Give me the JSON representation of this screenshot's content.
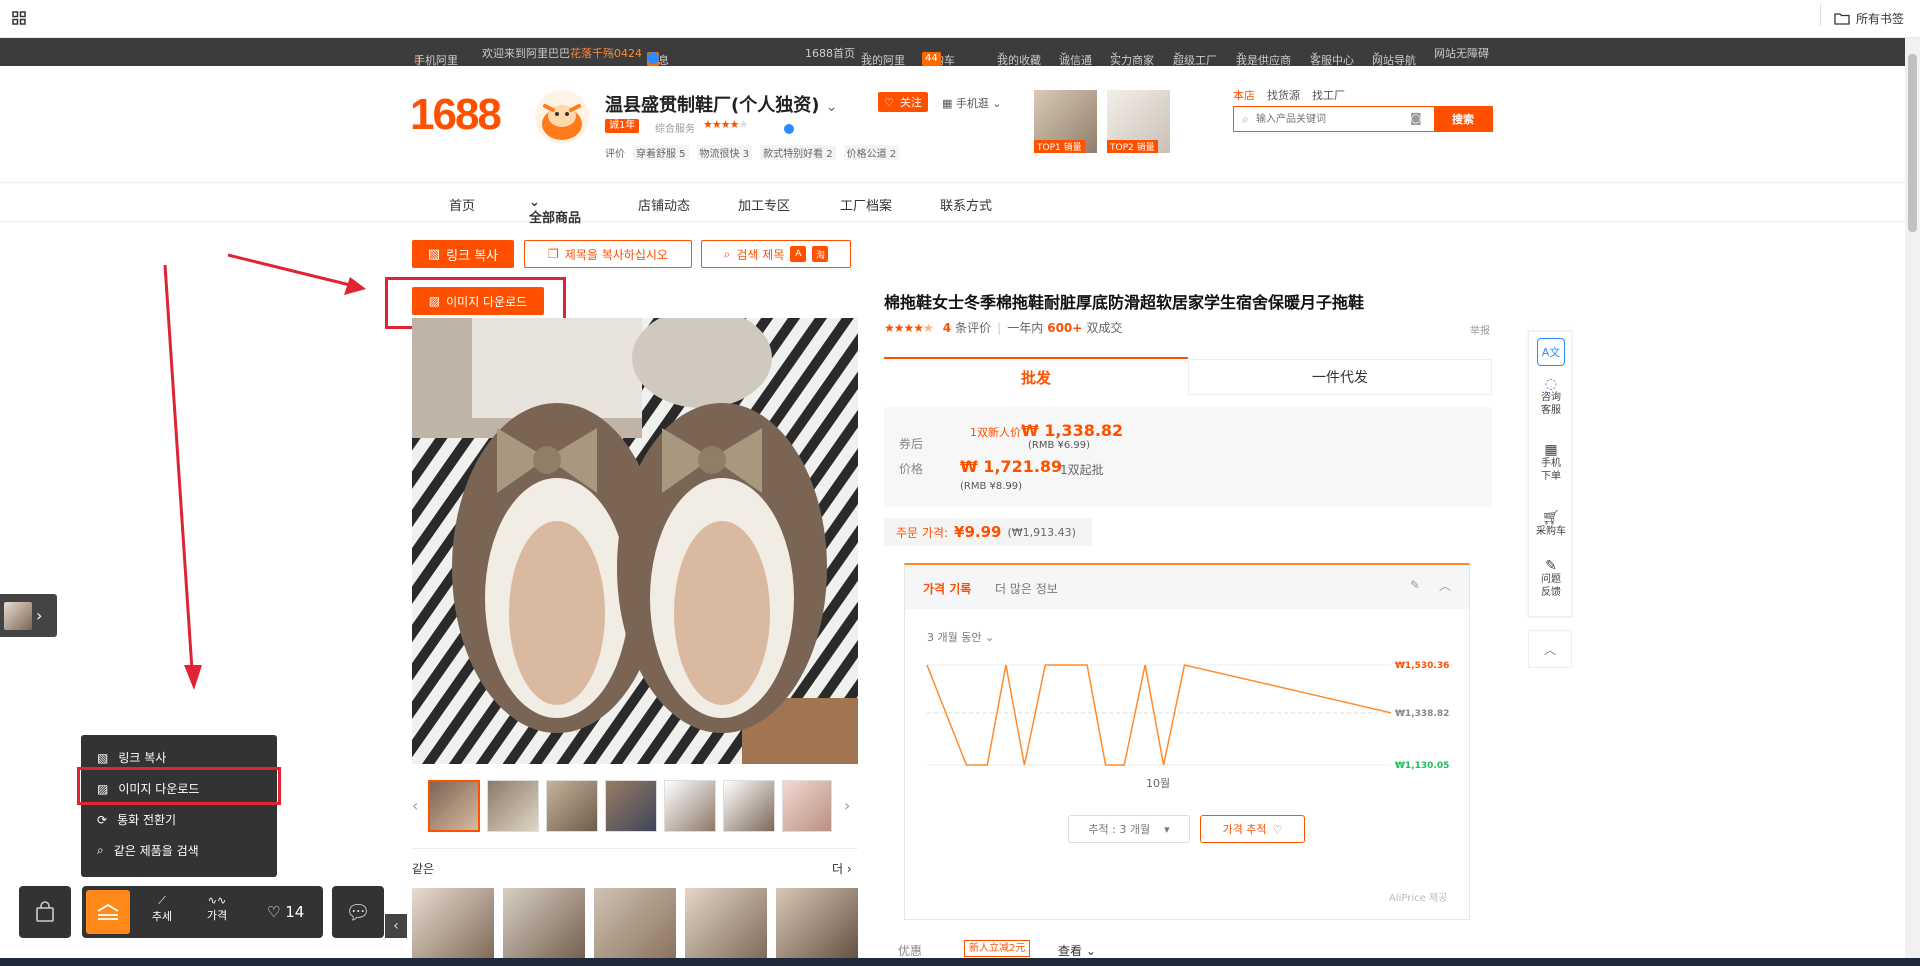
{
  "browser": {
    "bookmarks_label": "所有书签"
  },
  "topbar": {
    "mobile": "手机阿里",
    "welcome": "欢迎来到阿里巴巴",
    "user": "花落千殇0424",
    "messages": "消息",
    "messages_count": "3",
    "links": [
      "1688首页",
      "我的阿里",
      "采购车",
      "我的收藏",
      "诚信通",
      "实力商家",
      "超级工厂",
      "我是供应商",
      "客服中心",
      "网站导航",
      "网站无障碍"
    ],
    "cart_count": "44"
  },
  "header": {
    "logo": "1688",
    "shop_name": "温县盛贯制鞋厂(个人独资)",
    "years_badge": "诚1年",
    "service_label": "综合服务",
    "follow_label": "关注",
    "mobile_label": "手机逛",
    "ratings": [
      "评价",
      "穿着舒服 5",
      "物流很快 3",
      "款式特别好看 2",
      "价格公道 2"
    ],
    "top_badges": [
      "TOP1 销量",
      "TOP2 销量"
    ],
    "search_tabs": [
      "本店",
      "找货源",
      "找工厂"
    ],
    "search_placeholder": "输入产品关键词",
    "search_button": "搜索"
  },
  "nav": {
    "items": [
      "首页",
      "全部商品",
      "店铺动态",
      "加工专区",
      "工厂档案",
      "联系方式"
    ]
  },
  "tools": {
    "copy_link": "링크 복사",
    "copy_title": "제목을 복사하십시오",
    "search_title": "검색 제목",
    "download_image": "이미지 다운로드"
  },
  "product": {
    "title": "棉拖鞋女士冬季棉拖鞋耐脏厚底防滑超软居家学生宿舍保暖月子拖鞋",
    "review_count": "4",
    "review_label": "条评价",
    "sales_prefix": "一年内",
    "sales_count": "600+",
    "sales_suffix": "双成交",
    "report": "举报",
    "tabs": [
      "批发",
      "一件代发"
    ],
    "coupon_label": "券后",
    "coupon_prefix": "1双新人价",
    "coupon_price": "₩ 1,338.82",
    "coupon_rmb": "(RMB ¥6.99)",
    "price_label": "价格",
    "price": "₩ 1,721.89",
    "min_order": "1双起批",
    "price_rmb": "(RMB ¥8.99)",
    "order_price_label": "주문 가격:",
    "order_price": "¥9.99",
    "order_price_krw": "(₩1,913.43)",
    "related_label": "같은",
    "related_more": "더",
    "discount_label": "优惠",
    "discount_badge": "新人立减2元",
    "discount_view": "查看"
  },
  "price_history": {
    "tab_active": "가격 기록",
    "tab_other": "더 많은 정보",
    "period": "3 개월 동안",
    "x_tick": "10월",
    "track_select": "추적 : 3 개월",
    "track_button": "가격 추적",
    "provider": "AliPrice 제공"
  },
  "chart_data": {
    "type": "line",
    "y_labels": [
      "₩1,530.36",
      "₩1,338.82",
      "₩1,130.05"
    ],
    "y_values": [
      1530.36,
      1338.82,
      1130.05
    ],
    "x_tick": "10월",
    "series": [
      {
        "values": [
          1530.36,
          1130.05,
          1130.05,
          1530.36,
          1130.05,
          1530.36,
          1530.36,
          1530.36,
          1130.05,
          1130.05,
          1530.36,
          1130.05,
          1530.36,
          1338.82
        ]
      }
    ],
    "colors": {
      "line": "#ff8a2a",
      "max_label": "#ff5000",
      "min_label": "#1ec15a"
    }
  },
  "right_sidebar": {
    "items": [
      "咨询客服",
      "手机下单",
      "采购车",
      "问题反馈"
    ]
  },
  "popup_menu": {
    "items": [
      "링크 복사",
      "이미지 다운로드",
      "통화 전환기",
      "같은 제품을 검색"
    ]
  },
  "bottom_toolbar": {
    "trend": "추세",
    "price": "가격",
    "likes": "14"
  },
  "colors": {
    "brand": "#ff5000",
    "dark_bar": "#3c3c3c",
    "highlight": "#e02433"
  }
}
